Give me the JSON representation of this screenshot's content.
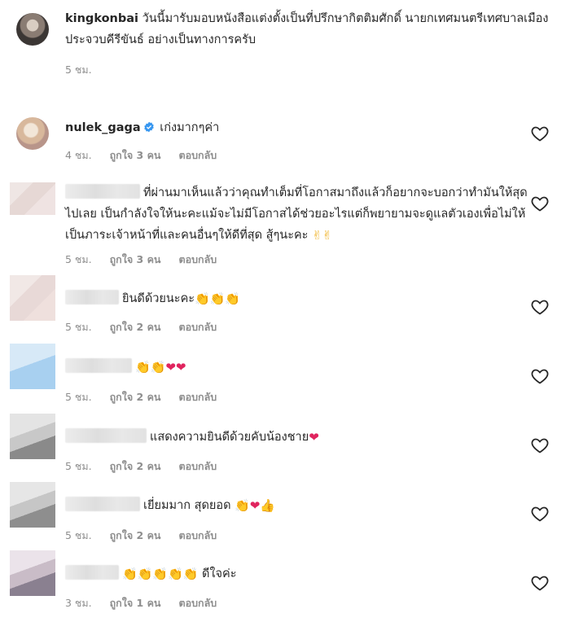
{
  "caption": {
    "username": "kingkonbai",
    "text": "วันนี้มารับมอบหนังสือแต่งตั้งเป็นที่ปรึกษากิตติมศักดิ์ นายกเทศมนตรีเทศบาลเมืองประจวบคีรีขันธ์ อย่างเป็นทางการครับ",
    "time": "5 ชม."
  },
  "comments": [
    {
      "username": "nulek_gaga",
      "verified": true,
      "text": "เก่งมากๆค่า",
      "time": "4 ชม.",
      "likes": "ถูกใจ 3 คน",
      "reply": "ตอบกลับ"
    },
    {
      "username": "",
      "text": "ที่ผ่านมาเห็นแล้วว่าคุณทำเต็มที่โอกาสมาถึงแล้วก็อยากจะบอกว่าทำมันให้สุดไปเลย เป็นกำลังใจให้นะคะแม้จะไม่มีโอกาสได้ช่วยอะไรแต่ก็พยายามจะดูแลตัวเองเพื่อไม่ให้เป็นภาระเจ้าหน้าที่และคนอื่นๆให้ดีที่สุด สู้ๆนะคะ",
      "emoji": "✌✌",
      "time": "5 ชม.",
      "likes": "ถูกใจ 3 คน",
      "reply": "ตอบกลับ"
    },
    {
      "username": "",
      "text": "ยินดีด้วยนะคะ",
      "emoji": "👏👏👏",
      "time": "5 ชม.",
      "likes": "ถูกใจ 2 คน",
      "reply": "ตอบกลับ"
    },
    {
      "username": "",
      "text": "",
      "emoji": "👏👏❤❤",
      "time": "5 ชม.",
      "likes": "ถูกใจ 2 คน",
      "reply": "ตอบกลับ"
    },
    {
      "username": "",
      "text": "แสดงความยินดีด้วยคับน้องชาย",
      "emoji": "❤",
      "time": "5 ชม.",
      "likes": "ถูกใจ 2 คน",
      "reply": "ตอบกลับ"
    },
    {
      "username": "",
      "text": "เยี่ยมมาก สุดยอด",
      "emoji": "👏❤👍",
      "time": "5 ชม.",
      "likes": "ถูกใจ 2 คน",
      "reply": "ตอบกลับ"
    },
    {
      "username": "",
      "text": "ดีใจค่ะ",
      "emoji_before": "👏👏👏👏👏",
      "time": "3 ชม.",
      "likes": "ถูกใจ 1 คน",
      "reply": "ตอบกลับ"
    }
  ],
  "icons": {
    "like": "heart-outline-icon",
    "verified": "verified-badge-icon"
  },
  "colors": {
    "text": "#262626",
    "meta": "#8e8e8e",
    "verified": "#3897f0"
  }
}
